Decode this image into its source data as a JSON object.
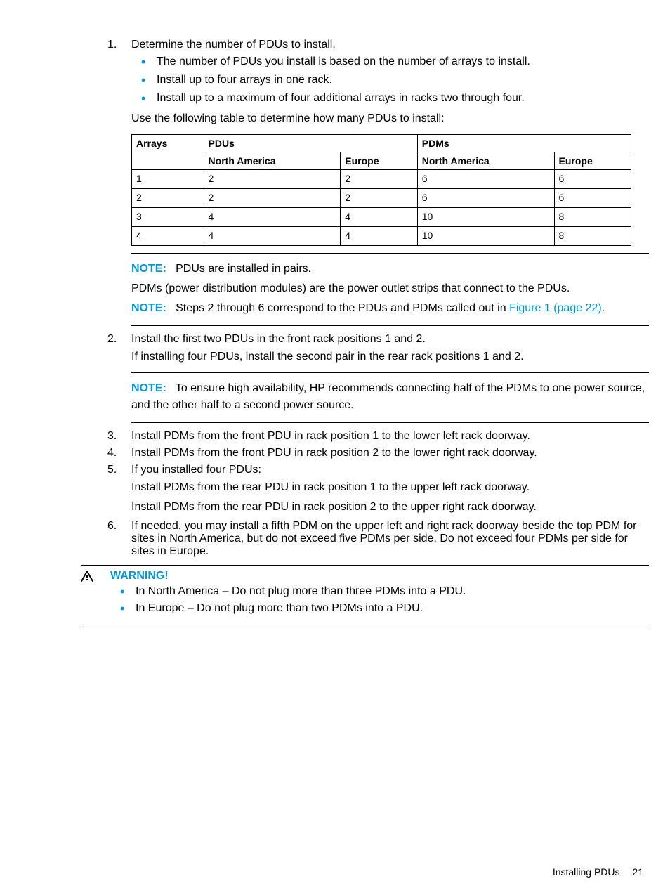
{
  "steps": {
    "s1": {
      "num": "1.",
      "text": "Determine the number of PDUs to install.",
      "bullets": [
        "The number of PDUs you install is based on the number of arrays to install.",
        "Install up to four arrays in one rack.",
        "Install up to a maximum of four additional arrays in racks two through four."
      ],
      "tail": "Use the following table to determine how many PDUs to install:"
    },
    "s2": {
      "num": "2.",
      "line1": "Install the first two PDUs in the front rack positions 1 and 2.",
      "line2": "If installing four PDUs, install the second pair in the rear rack positions 1 and 2."
    },
    "s3": {
      "num": "3.",
      "text": "Install PDMs from the front PDU in rack position 1 to the lower left rack doorway."
    },
    "s4": {
      "num": "4.",
      "text": "Install PDMs from the front PDU in rack position 2 to the lower right rack doorway."
    },
    "s5": {
      "num": "5.",
      "line1": "If you installed four PDUs:",
      "line2": "Install PDMs from the rear PDU in rack position 1 to the upper left rack doorway.",
      "line3": "Install PDMs from the rear PDU in rack position 2 to the upper right rack doorway."
    },
    "s6": {
      "num": "6.",
      "text": "If needed, you may install a fifth PDM on the upper left and right rack doorway beside the top PDM for sites in North America, but do not exceed five PDMs per side. Do not exceed four PDMs per side for sites in Europe."
    }
  },
  "table": {
    "headers": {
      "arrays": "Arrays",
      "pdus": "PDUs",
      "pdms": "PDMs",
      "na": "North America",
      "eu": "Europe"
    },
    "rows": [
      {
        "arrays": "1",
        "pdu_na": "2",
        "pdu_eu": "2",
        "pdm_na": "6",
        "pdm_eu": "6"
      },
      {
        "arrays": "2",
        "pdu_na": "2",
        "pdu_eu": "2",
        "pdm_na": "6",
        "pdm_eu": "6"
      },
      {
        "arrays": "3",
        "pdu_na": "4",
        "pdu_eu": "4",
        "pdm_na": "10",
        "pdm_eu": "8"
      },
      {
        "arrays": "4",
        "pdu_na": "4",
        "pdu_eu": "4",
        "pdm_na": "10",
        "pdm_eu": "8"
      }
    ]
  },
  "notes": {
    "label": "NOTE:",
    "n1_line1": "PDUs are installed in pairs.",
    "n1_line2": "PDMs (power distribution modules) are the power outlet strips that connect to the PDUs.",
    "n2_pre": "Steps 2 through 6 correspond to the PDUs and PDMs called out in ",
    "n2_link": "Figure 1 (page 22)",
    "n2_post": ".",
    "n3": "To ensure high availability, HP recommends connecting half of the PDMs to one power source, and the other half to a second power source."
  },
  "warning": {
    "label": "WARNING!",
    "items": [
      "In North America – Do not plug more than three PDMs into a PDU.",
      "In Europe – Do not plug more than two PDMs into a PDU."
    ]
  },
  "footer": {
    "section": "Installing PDUs",
    "page": "21"
  },
  "chart_data": {
    "type": "table",
    "title": "PDUs and PDMs required by number of arrays",
    "columns": [
      "Arrays",
      "PDUs North America",
      "PDUs Europe",
      "PDMs North America",
      "PDMs Europe"
    ],
    "rows": [
      [
        1,
        2,
        2,
        6,
        6
      ],
      [
        2,
        2,
        2,
        6,
        6
      ],
      [
        3,
        4,
        4,
        10,
        8
      ],
      [
        4,
        4,
        4,
        10,
        8
      ]
    ]
  }
}
